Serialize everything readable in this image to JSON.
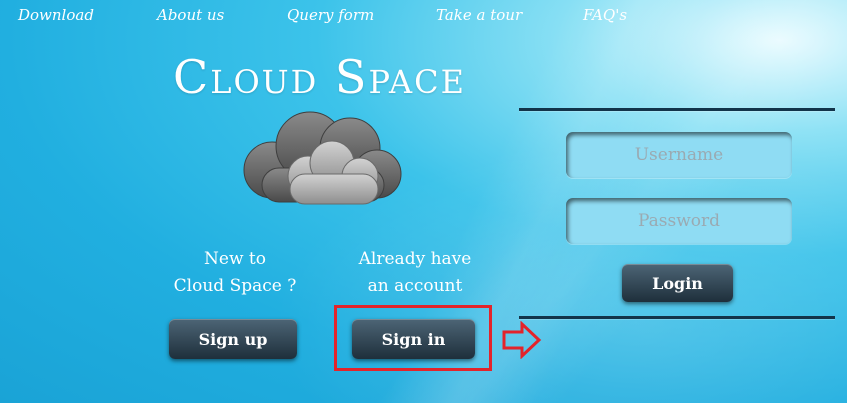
{
  "nav": {
    "items": [
      "Download",
      "About us",
      "Query form",
      "Take a tour",
      "FAQ's"
    ]
  },
  "brand": {
    "title": "Cloud Space"
  },
  "signup": {
    "caption_line1": "New to",
    "caption_line2": "Cloud Space ?",
    "button_label": "Sign up"
  },
  "signin": {
    "caption_line1": "Already have",
    "caption_line2": "an account",
    "button_label": "Sign in"
  },
  "login_form": {
    "username_placeholder": "Username",
    "username_value": "",
    "password_placeholder": "Password",
    "password_value": "",
    "login_label": "Login"
  },
  "colors": {
    "highlight": "#e3242b",
    "button_dark": "#1e2f3b",
    "divider": "#12344a"
  },
  "icons": {
    "logo": "cloud-icon",
    "pointer": "arrow-right-icon"
  }
}
